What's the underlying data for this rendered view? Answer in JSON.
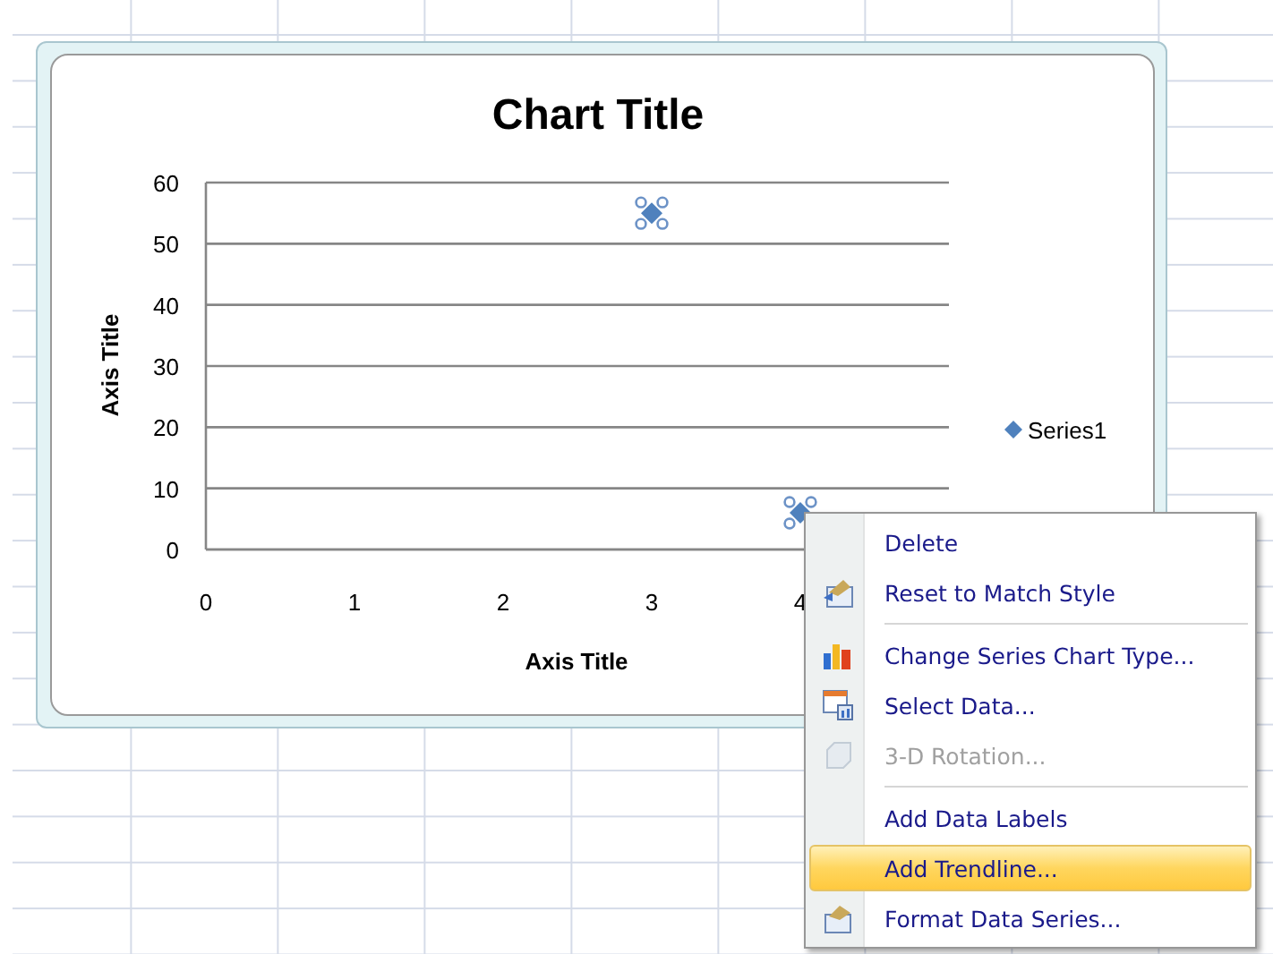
{
  "chart": {
    "chart_data": {
      "type": "scatter",
      "title": "Chart Title",
      "xlabel": "Axis Title",
      "ylabel": "Axis Title",
      "xlim": [
        0,
        5
      ],
      "ylim": [
        0,
        60
      ],
      "xticks": [
        0,
        1,
        2,
        3,
        4
      ],
      "yticks": [
        0,
        10,
        20,
        30,
        40,
        50,
        60
      ],
      "grid": true,
      "series": [
        {
          "name": "Series1",
          "color": "#4f81bd",
          "x": [
            3,
            4
          ],
          "values": [
            55,
            6
          ]
        }
      ]
    },
    "series_selected": true
  },
  "context_menu": {
    "items": [
      {
        "kind": "item",
        "label": "Delete",
        "disabled": false,
        "selected": false
      },
      {
        "kind": "item",
        "label": "Reset to Match Style",
        "disabled": false,
        "selected": false
      },
      {
        "kind": "separator"
      },
      {
        "kind": "item",
        "label": "Change Series Chart Type...",
        "disabled": false,
        "selected": false
      },
      {
        "kind": "item",
        "label": "Select Data...",
        "disabled": false,
        "selected": false
      },
      {
        "kind": "item",
        "label": "3-D Rotation...",
        "disabled": true,
        "selected": false
      },
      {
        "kind": "separator"
      },
      {
        "kind": "item",
        "label": "Add Data Labels",
        "disabled": false,
        "selected": false
      },
      {
        "kind": "item",
        "label": "Add Trendline...",
        "disabled": false,
        "selected": true
      },
      {
        "kind": "item",
        "label": "Format Data Series...",
        "disabled": false,
        "selected": false
      }
    ]
  }
}
